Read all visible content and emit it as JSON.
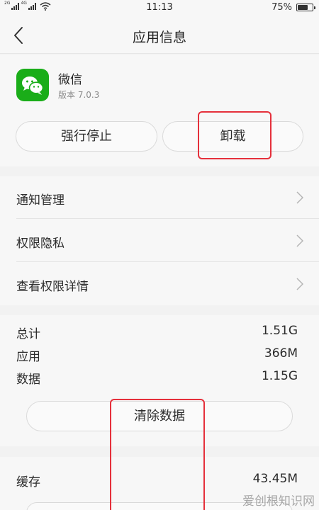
{
  "status_bar": {
    "signal_1_label": "2G",
    "signal_2_label": "4G",
    "time": "11:13",
    "battery_percent_text": "75%",
    "battery_level": 0.75
  },
  "header": {
    "title": "应用信息",
    "back_icon": "chevron-left-icon"
  },
  "app": {
    "name": "微信",
    "version": "版本 7.0.3",
    "icon": "wechat-icon",
    "icon_color": "#1aad19"
  },
  "actions": {
    "force_stop_label": "强行停止",
    "uninstall_label": "卸载"
  },
  "menu": {
    "items": [
      {
        "label": "通知管理"
      },
      {
        "label": "权限隐私"
      },
      {
        "label": "查看权限详情"
      }
    ]
  },
  "storage": {
    "rows": [
      {
        "label": "总计",
        "value": "1.51G"
      },
      {
        "label": "应用",
        "value": "366M"
      },
      {
        "label": "数据",
        "value": "1.15G"
      }
    ],
    "clear_data_label": "清除数据"
  },
  "cache": {
    "label": "缓存",
    "value": "43.45M"
  },
  "annotation_color": "#e5303b",
  "watermark": "爱创根知识网"
}
